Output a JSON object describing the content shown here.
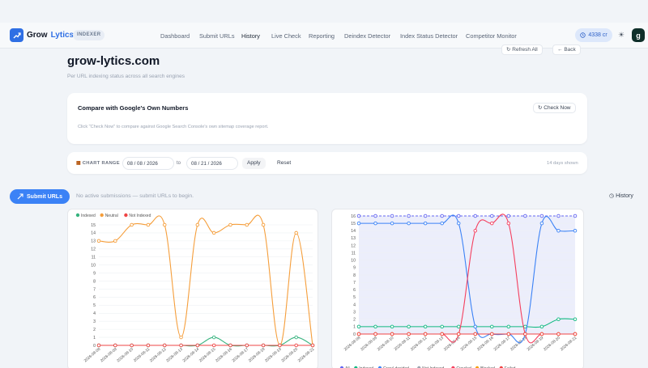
{
  "app": {
    "name_part1": "Grow",
    "name_part2": "Lytics",
    "badge": "INDEXER"
  },
  "nav": [
    {
      "label": "Dashboard"
    },
    {
      "label": "Submit URLs"
    },
    {
      "label": "History"
    },
    {
      "label": "Live Check"
    },
    {
      "label": "Reporting"
    },
    {
      "label": "Deindex Detector"
    },
    {
      "label": "Index Status Detector"
    },
    {
      "label": "Competitor Monitor"
    }
  ],
  "header": {
    "credits": "4338 cr",
    "avatar_letter": "g",
    "theme_icon": "sun-icon"
  },
  "page": {
    "title": "grow-lytics.com",
    "subtitle": "Per URL indexing status across all search engines",
    "refresh_label": "Refresh All",
    "back_label": "Back"
  },
  "compare": {
    "title": "Compare with Google's Own Numbers",
    "check_label": "Check Now",
    "text": "Click \"Check Now\" to compare against Google Search Console's own sitemap coverage report."
  },
  "range": {
    "label": "CHART RANGE",
    "from": "08 / 08 / 2026",
    "to_word": "to",
    "to": "08 / 21 / 2026",
    "apply": "Apply",
    "reset": "Reset",
    "days_shown": "14 days shown"
  },
  "submissions": {
    "submit_label": "Submit URLs",
    "empty_text": "No active submissions — submit URLs to begin.",
    "history_label": "History"
  },
  "chart_data": [
    {
      "type": "line",
      "title": "",
      "x": [
        "2026-08-08",
        "2026-08-09",
        "2026-08-10",
        "2026-08-11",
        "2026-08-12",
        "2026-08-13",
        "2026-08-14",
        "2026-08-15",
        "2026-08-16",
        "2026-08-17",
        "2026-08-18",
        "2026-08-19",
        "2026-08-20",
        "2026-08-21"
      ],
      "ylim": [
        0,
        15
      ],
      "yticks": [
        0,
        1,
        2,
        3,
        4,
        5,
        6,
        7,
        8,
        9,
        10,
        11,
        12,
        13,
        14,
        15
      ],
      "legend_position": "top-left",
      "series": [
        {
          "name": "Indexed",
          "color": "#36b37e",
          "values": [
            0,
            0,
            0,
            0,
            0,
            0,
            0,
            1,
            0,
            0,
            0,
            0,
            1,
            0
          ]
        },
        {
          "name": "Neutral",
          "color": "#f59e3b",
          "values": [
            13,
            13,
            15,
            15,
            15,
            1,
            15,
            14,
            15,
            15,
            15,
            0,
            14,
            0
          ]
        },
        {
          "name": "Not Indexed",
          "color": "#ef4444",
          "values": [
            0,
            0,
            0,
            0,
            0,
            0,
            0,
            0,
            0,
            0,
            0,
            0,
            0,
            0
          ]
        }
      ]
    },
    {
      "type": "line",
      "title": "",
      "x": [
        "2026-08-08",
        "2026-08-09",
        "2026-08-10",
        "2026-08-11",
        "2026-08-12",
        "2026-08-13",
        "2026-08-14",
        "2026-08-15",
        "2026-08-16",
        "2026-08-17",
        "2026-08-18",
        "2026-08-19",
        "2026-08-20",
        "2026-08-21"
      ],
      "ylim": [
        0,
        16
      ],
      "yticks": [
        0,
        1,
        2,
        3,
        4,
        5,
        6,
        7,
        8,
        9,
        10,
        11,
        12,
        13,
        14,
        15,
        16
      ],
      "legend_position": "bottom",
      "series": [
        {
          "name": "All",
          "color": "#6366f1",
          "dashed": true,
          "values": [
            16,
            16,
            16,
            16,
            16,
            16,
            16,
            16,
            16,
            16,
            16,
            16,
            16,
            16
          ]
        },
        {
          "name": "Indexed",
          "color": "#10b981",
          "values": [
            1,
            1,
            1,
            1,
            1,
            1,
            1,
            1,
            1,
            1,
            1,
            1,
            2,
            2
          ]
        },
        {
          "name": "Crawl-decided",
          "color": "#3b82f6",
          "values": [
            15,
            15,
            15,
            15,
            15,
            15,
            15,
            1,
            0,
            0,
            0,
            15,
            14,
            14
          ]
        },
        {
          "name": "Not Indexed",
          "color": "#9ca3af",
          "values": [
            0,
            0,
            0,
            0,
            0,
            0,
            0,
            0,
            0,
            0,
            0,
            0,
            0,
            0
          ]
        },
        {
          "name": "Crawled",
          "color": "#f43f5e",
          "values": [
            0,
            0,
            0,
            0,
            0,
            0,
            0,
            14,
            15,
            15,
            0,
            0,
            0,
            0
          ]
        },
        {
          "name": "Blocked",
          "color": "#f59e0b",
          "values": [
            0,
            0,
            0,
            0,
            0,
            0,
            0,
            0,
            0,
            0,
            0,
            0,
            0,
            0
          ]
        },
        {
          "name": "Failed",
          "color": "#ef4444",
          "values": [
            0,
            0,
            0,
            0,
            0,
            0,
            0,
            0,
            0,
            0,
            0,
            0,
            0,
            0
          ]
        }
      ]
    }
  ]
}
